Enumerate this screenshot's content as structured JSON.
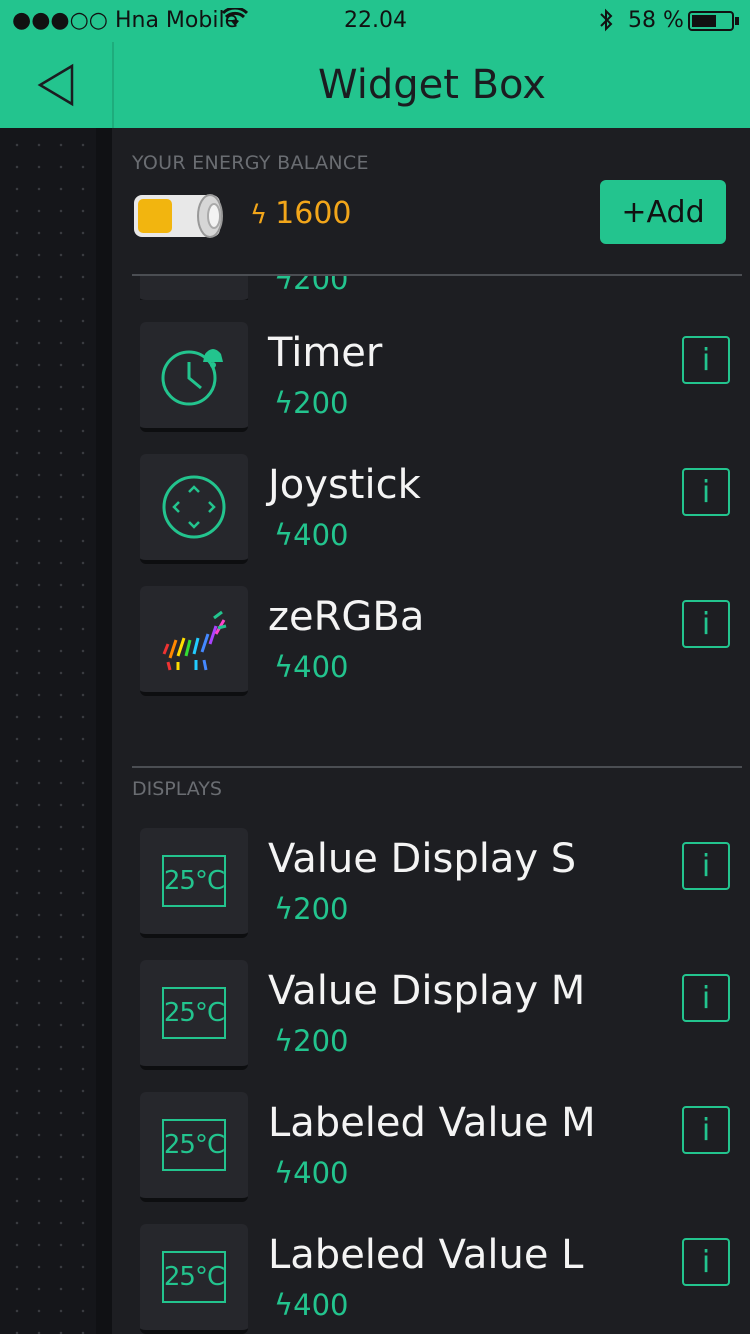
{
  "status": {
    "carrier": "●●●○○ Hna Mobile",
    "time": "22.04",
    "battery": "58 %"
  },
  "header": {
    "title": "Widget Box"
  },
  "energy": {
    "label": "YOUR ENERGY BALANCE",
    "value": "1600",
    "add_label": "+Add"
  },
  "partial_item": {
    "cost": "200"
  },
  "controllers": [
    {
      "name": "Timer",
      "cost": "200",
      "icon": "timer-icon"
    },
    {
      "name": "Joystick",
      "cost": "400",
      "icon": "joystick-icon"
    },
    {
      "name": "zeRGBa",
      "cost": "400",
      "icon": "zebra-icon"
    }
  ],
  "displays_label": "DISPLAYS",
  "displays": [
    {
      "name": "Value Display S",
      "cost": "200",
      "icon_text": "25°C"
    },
    {
      "name": "Value Display M",
      "cost": "200",
      "icon_text": "25°C"
    },
    {
      "name": "Labeled Value M",
      "cost": "400",
      "icon_text": "25°C"
    },
    {
      "name": "Labeled Value L",
      "cost": "400",
      "icon_text": "25°C"
    }
  ],
  "info_label": "i",
  "colors": {
    "accent": "#23c48e",
    "energy": "#f2a61a",
    "panel": "#1d1e22"
  }
}
